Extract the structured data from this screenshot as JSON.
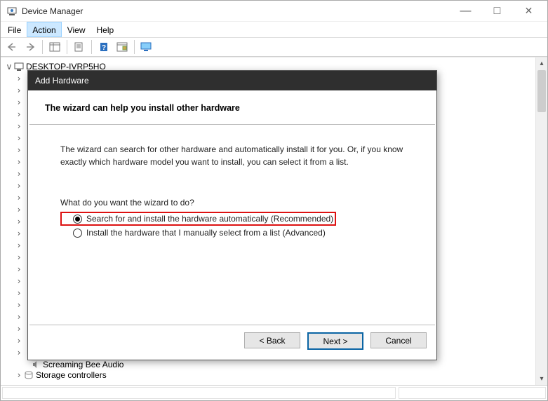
{
  "window": {
    "title": "Device Manager",
    "controls": {
      "min": "—",
      "max": "□",
      "close": "✕"
    }
  },
  "menubar": [
    "File",
    "Action",
    "View",
    "Help"
  ],
  "tree": {
    "root": "DESKTOP-IVRP5HO",
    "last_visible_children": [
      "Screaming Bee Audio",
      "Storage controllers"
    ]
  },
  "dialog": {
    "title": "Add Hardware",
    "heading": "The wizard can help you install other hardware",
    "description": "The wizard can search for other hardware and automatically install it for you. Or, if you know exactly which hardware model you want to install, you can select it from a list.",
    "question": "What do you want the wizard to do?",
    "options": {
      "auto": "Search for and install the hardware automatically (Recommended)",
      "manual": "Install the hardware that I manually select from a list (Advanced)"
    },
    "buttons": {
      "back": "< Back",
      "next": "Next >",
      "cancel": "Cancel"
    }
  }
}
